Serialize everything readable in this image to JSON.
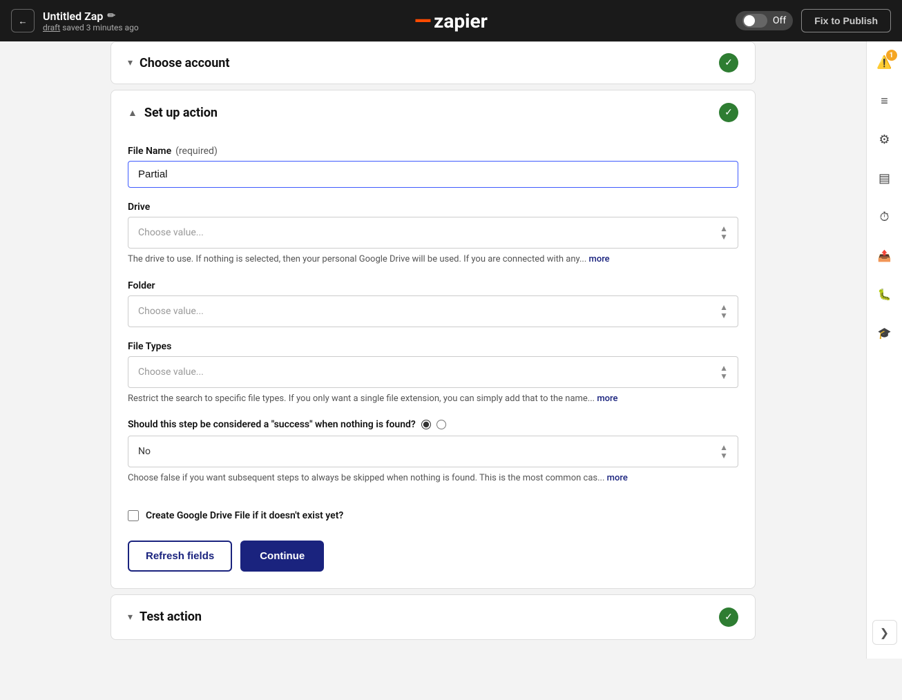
{
  "header": {
    "back_label": "←",
    "zap_title": "Untitled Zap",
    "edit_icon": "✏",
    "save_status": "draft",
    "saved_time": "saved 3 minutes ago",
    "logo_dash": "—",
    "logo_text": "zapier",
    "toggle_label": "Off",
    "publish_button": "Fix to Publish"
  },
  "sidebar": {
    "icons": [
      {
        "name": "warning-icon",
        "symbol": "⚠",
        "badge": "1"
      },
      {
        "name": "list-icon",
        "symbol": "≡"
      },
      {
        "name": "settings-icon",
        "symbol": "⚙"
      },
      {
        "name": "layers-icon",
        "symbol": "▤"
      },
      {
        "name": "clock-icon",
        "symbol": "⏱"
      },
      {
        "name": "upload-icon",
        "symbol": "⬆"
      },
      {
        "name": "bug-icon",
        "symbol": "🐛"
      },
      {
        "name": "education-icon",
        "symbol": "🎓"
      }
    ],
    "collapse_label": "❯"
  },
  "choose_account": {
    "title": "Choose account",
    "chevron": "▾"
  },
  "setup_action": {
    "title": "Set up action",
    "fields": {
      "file_name": {
        "label": "File Name",
        "required_text": "(required)",
        "value": "Partial"
      },
      "drive": {
        "label": "Drive",
        "placeholder": "Choose value...",
        "description": "The drive to use. If nothing is selected, then your personal Google Drive will be used. If you are connected with any...",
        "more_link": "more"
      },
      "folder": {
        "label": "Folder",
        "placeholder": "Choose value..."
      },
      "file_types": {
        "label": "File Types",
        "placeholder": "Choose value...",
        "description": "Restrict the search to specific file types. If you only want a single file extension, you can simply add that to the name...",
        "more_link": "more"
      },
      "success_question": {
        "label": "Should this step be considered a \"success\" when nothing is found?",
        "radio1_value": "yes",
        "radio2_value": "no",
        "select_value": "No",
        "description": "Choose false if you want subsequent steps to always be skipped when nothing is found. This is the most common cas...",
        "more_link": "more"
      },
      "create_file": {
        "label": "Create Google Drive File if it doesn't exist yet?"
      }
    },
    "buttons": {
      "refresh": "Refresh fields",
      "continue": "Continue"
    }
  },
  "test_action": {
    "title": "Test action"
  }
}
